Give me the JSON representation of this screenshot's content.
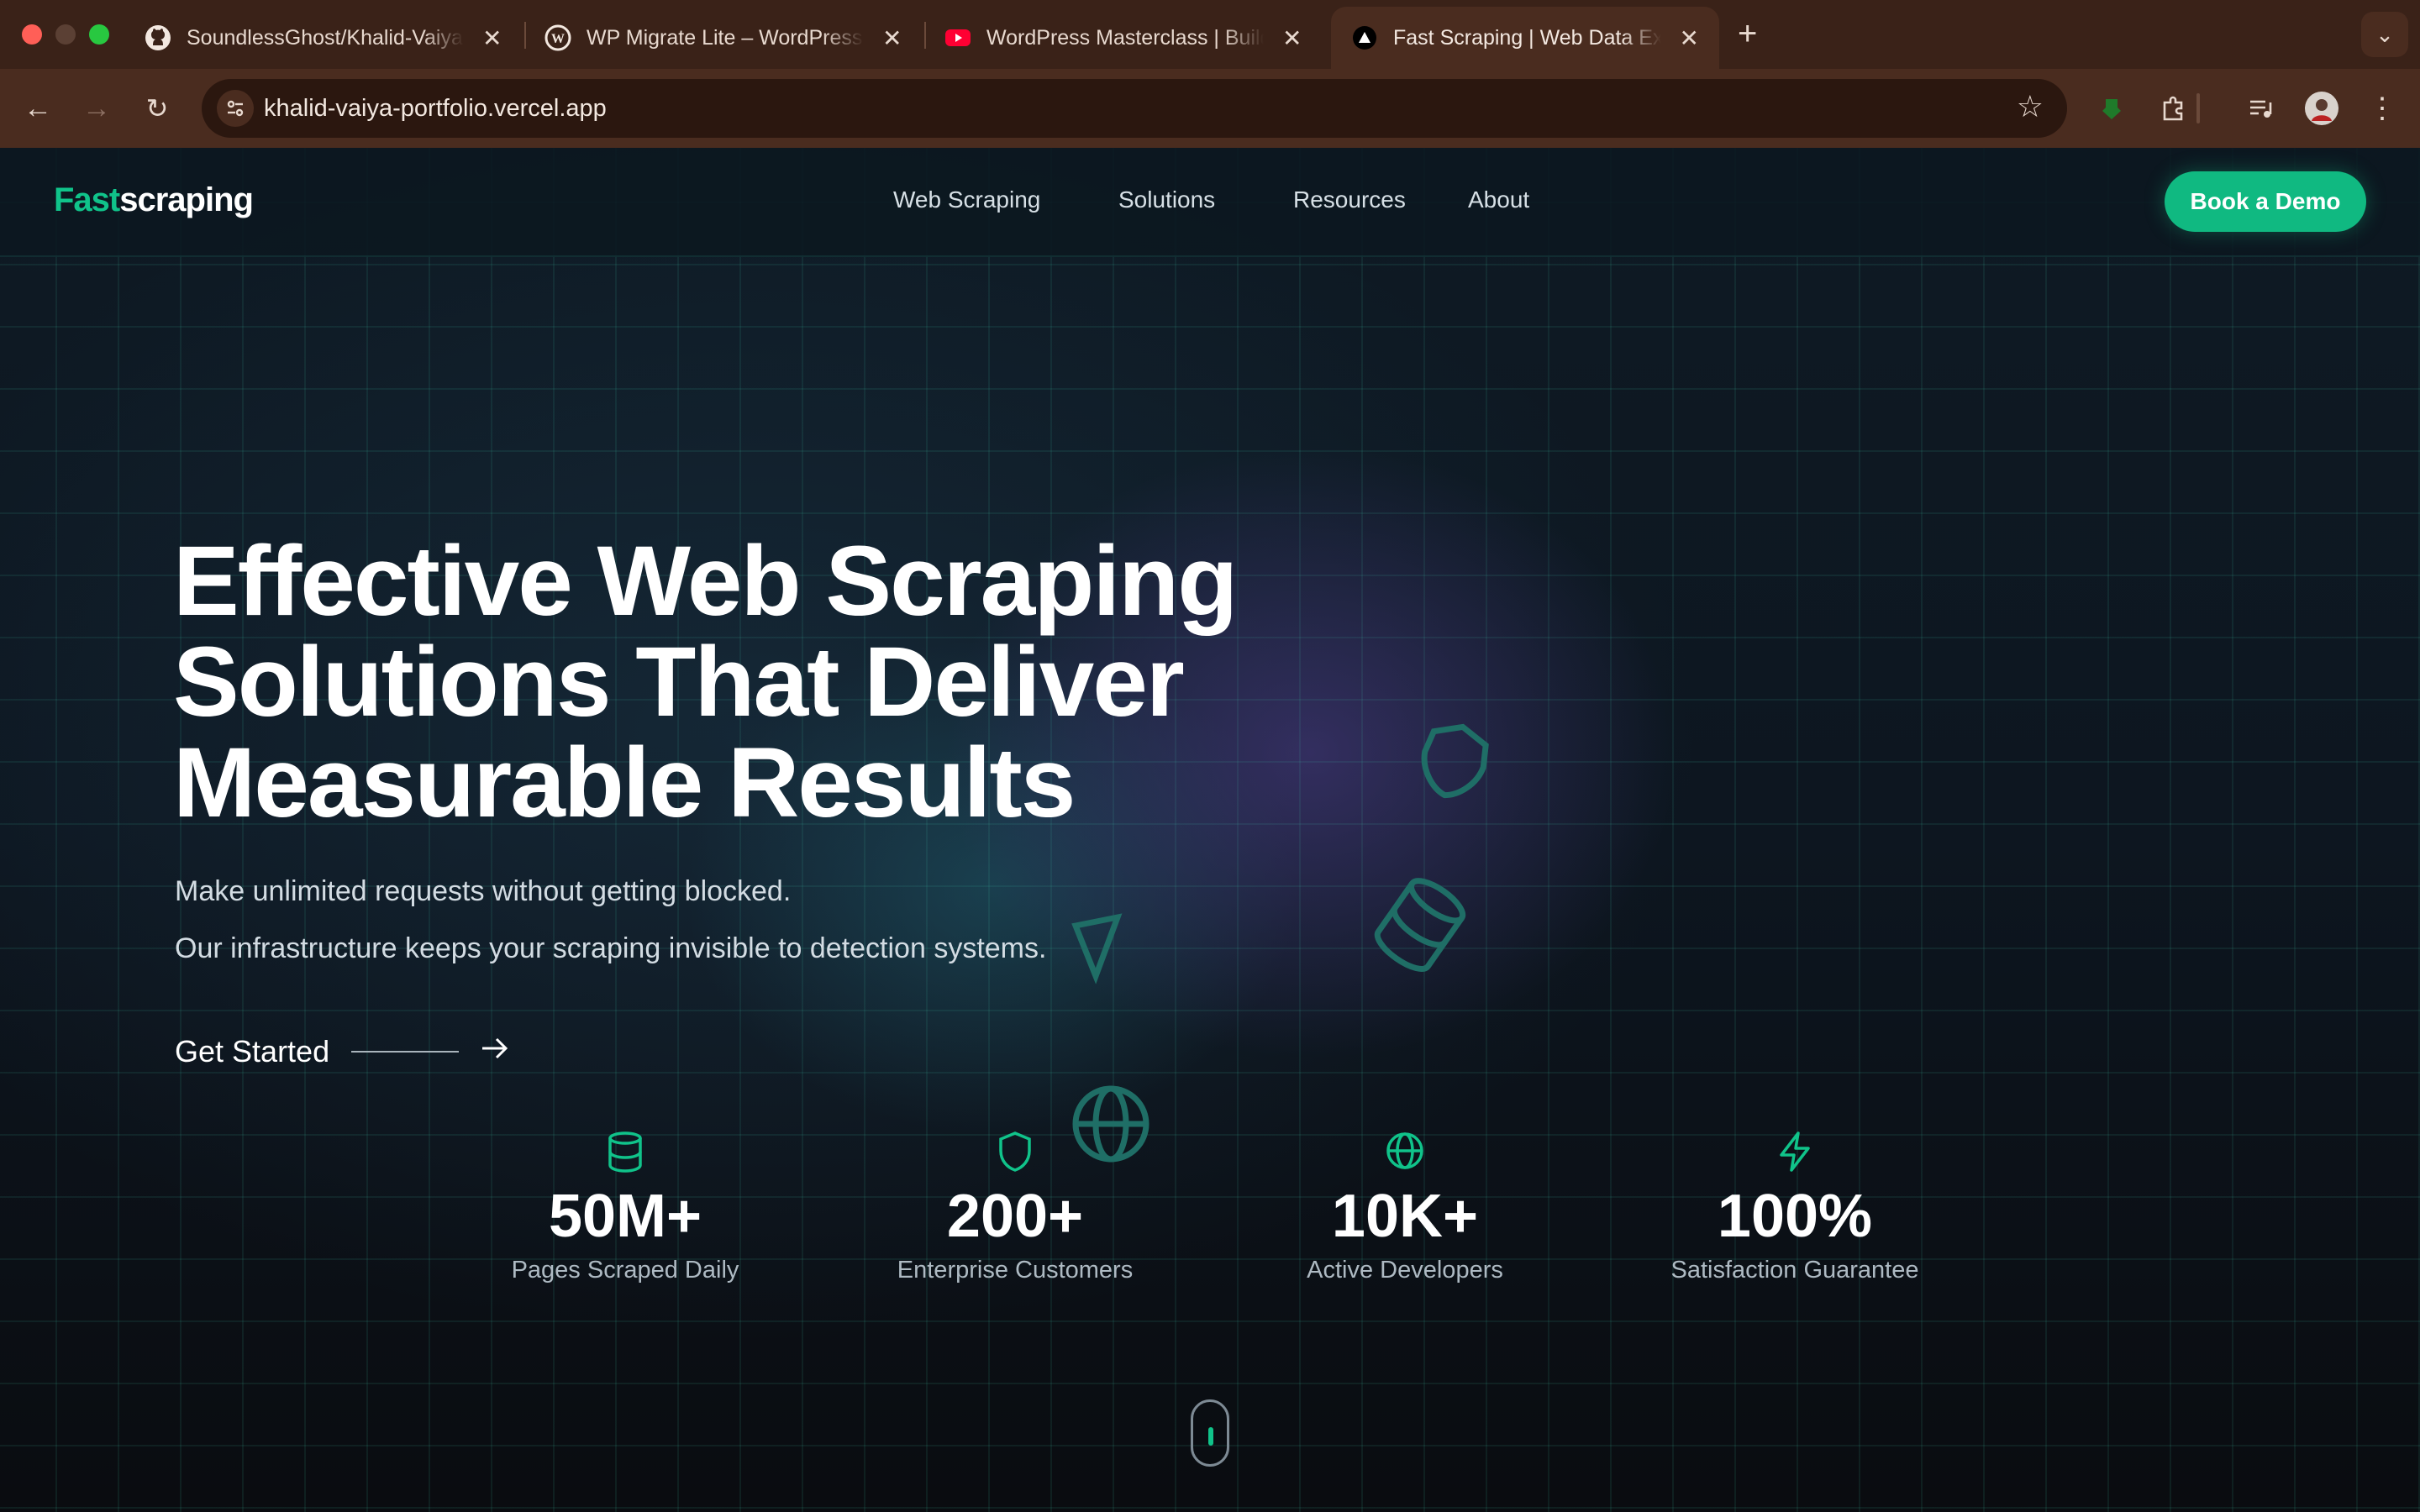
{
  "browser": {
    "tabs": [
      {
        "title": "SoundlessGhost/Khalid-Vaiya-Portfolio",
        "icon": "github-icon"
      },
      {
        "title": "WP Migrate Lite – WordPress Migration",
        "icon": "wordpress-icon"
      },
      {
        "title": "WordPress Masterclass | Build a Website",
        "icon": "youtube-icon"
      },
      {
        "title": "Fast Scraping | Web Data Experts",
        "icon": "vercel-icon",
        "active": true
      }
    ],
    "url": "khalid-vaiya-portfolio.vercel.app"
  },
  "nav": {
    "logo_part1": "Fast",
    "logo_part2": "scraping",
    "links": [
      "Web Scraping",
      "Solutions",
      "Resources",
      "About"
    ],
    "cta": "Book a Demo"
  },
  "hero": {
    "title_lines": [
      "Effective Web Scraping",
      "Solutions That Deliver",
      "Measurable Results"
    ],
    "subtitle_1": "Make unlimited requests without getting blocked.",
    "subtitle_2": "Our infrastructure keeps your scraping invisible to detection systems.",
    "cta": "Get Started"
  },
  "stats": [
    {
      "icon": "database-icon",
      "value": "50M+",
      "label": "Pages Scraped Daily"
    },
    {
      "icon": "shield-icon",
      "value": "200+",
      "label": "Enterprise Customers"
    },
    {
      "icon": "globe-icon",
      "value": "10K+",
      "label": "Active Developers"
    },
    {
      "icon": "lightning-icon",
      "value": "100%",
      "label": "Satisfaction Guarantee"
    }
  ],
  "colors": {
    "accent": "#10b981",
    "tabbar": "#3a2218",
    "toolbar": "#4a2c1f"
  }
}
